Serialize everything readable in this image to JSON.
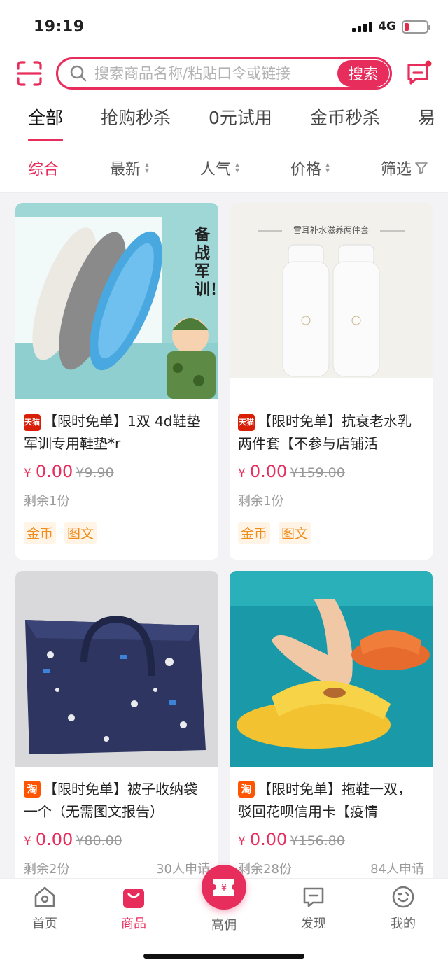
{
  "status": {
    "time": "19:19",
    "network": "4G"
  },
  "search": {
    "placeholder": "搜索商品名称/粘贴口令或链接",
    "button": "搜索"
  },
  "tabs": [
    "全部",
    "抢购秒杀",
    "0元试用",
    "金币秒杀",
    "易"
  ],
  "sorts": [
    "综合",
    "最新",
    "人气",
    "价格",
    "筛选"
  ],
  "products": [
    {
      "shop": "天猫",
      "title": "【限时免单】1双 4d鞋垫军训专用鞋垫*r",
      "price": "0.00",
      "yen": "¥",
      "orig": "¥9.90",
      "remain": "剩余1份",
      "applicants": "",
      "tags": [
        "金币",
        "图文"
      ],
      "img_text": "备战军训！"
    },
    {
      "shop": "天猫",
      "title": "【限时免单】抗衰老水乳两件套【不参与店铺活",
      "price": "0.00",
      "yen": "¥",
      "orig": "¥159.00",
      "remain": "剩余1份",
      "applicants": "",
      "tags": [
        "金币",
        "图文"
      ],
      "img_text": "雪耳补水滋养两件套"
    },
    {
      "shop": "淘",
      "title": "【限时免单】被子收纳袋一个（无需图文报告）",
      "price": "0.00",
      "yen": "¥",
      "orig": "¥80.00",
      "remain": "剩余2份",
      "applicants": "30人申请",
      "tags": [],
      "img_text": ""
    },
    {
      "shop": "淘",
      "title": "【限时免单】拖鞋一双，驳回花呗信用卡【疫情",
      "price": "0.00",
      "yen": "¥",
      "orig": "¥156.80",
      "remain": "剩余28份",
      "applicants": "84人申请",
      "tags": [],
      "img_text": ""
    }
  ],
  "tabbar": [
    "首页",
    "商品",
    "高佣",
    "发现",
    "我的"
  ],
  "colors": {
    "accent": "#e72d5c",
    "tag_bg": "#fff4e6",
    "tag_fg": "#f08b1c"
  }
}
